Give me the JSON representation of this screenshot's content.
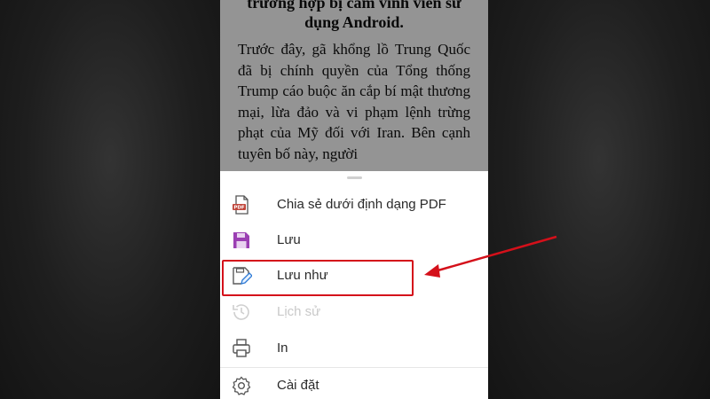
{
  "document": {
    "heading": "trường hợp bị cấm vĩnh viễn sử dụng Android.",
    "paragraph": "Trước đây, gã khổng lồ Trung Quốc đã bị chính quyền của Tổng thống Trump cáo buộc ăn cắp bí mật thương mại, lừa đảo và vi phạm lệnh trừng phạt của Mỹ đối với Iran. Bên cạnh tuyên bố này, người"
  },
  "menu": {
    "items": [
      {
        "label": "Chia sẻ dưới định dạng PDF",
        "icon": "pdf-icon",
        "enabled": true
      },
      {
        "label": "Lưu",
        "icon": "save-icon",
        "enabled": true
      },
      {
        "label": "Lưu như",
        "icon": "save-as-icon",
        "enabled": true
      },
      {
        "label": "Lịch sử",
        "icon": "history-icon",
        "enabled": false
      },
      {
        "label": "In",
        "icon": "print-icon",
        "enabled": true
      },
      {
        "label": "Cài đặt",
        "icon": "settings-icon",
        "enabled": true
      }
    ]
  },
  "colors": {
    "annotation": "#d4101a",
    "save_icon": "#9b3fb3",
    "pdf_icon": "#c0453a"
  }
}
